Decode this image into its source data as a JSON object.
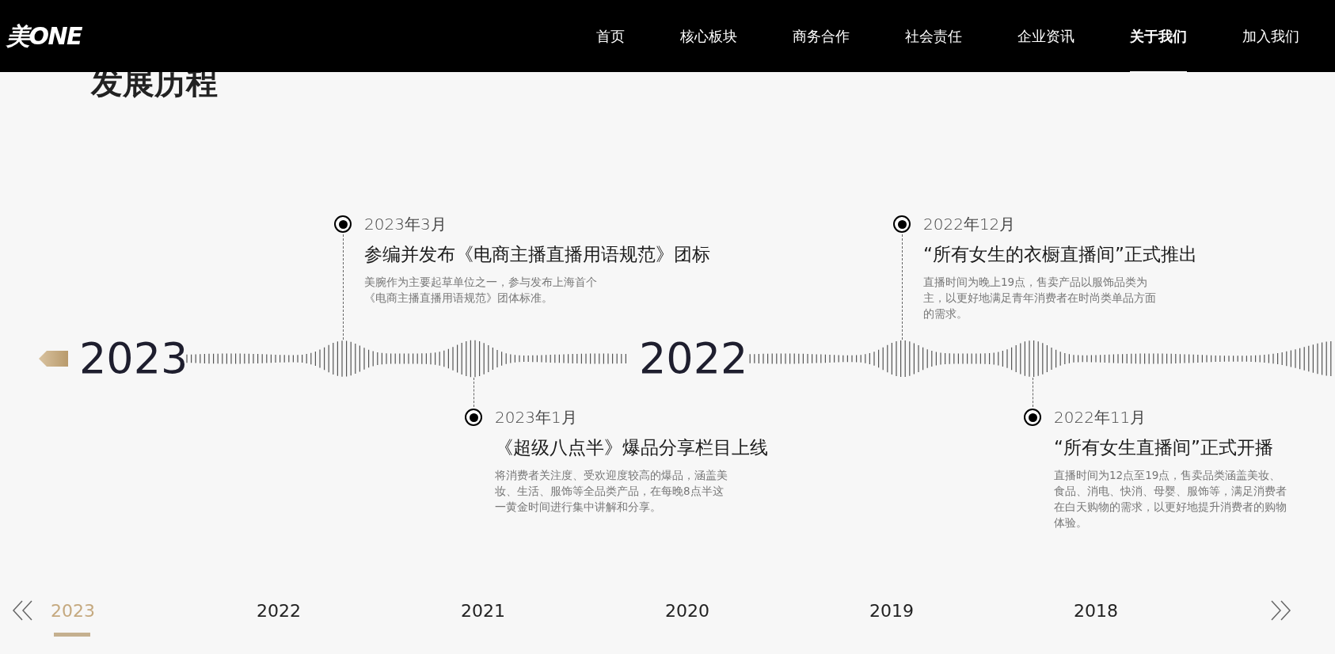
{
  "header": {
    "logo": "美ONE",
    "nav": [
      {
        "label": "首页",
        "selected": false
      },
      {
        "label": "核心板块",
        "selected": false
      },
      {
        "label": "商务合作",
        "selected": false
      },
      {
        "label": "社会责任",
        "selected": false
      },
      {
        "label": "企业资讯",
        "selected": false
      },
      {
        "label": "关于我们",
        "selected": true
      },
      {
        "label": "加入我们",
        "selected": false
      }
    ]
  },
  "section": {
    "title": "发展历程"
  },
  "timeline": {
    "years": [
      "2023",
      "2022"
    ],
    "events": [
      {
        "kind": "above",
        "date": "2023年3月",
        "title": "参编并发布《电商主播直播用语规范》团标",
        "description": "美腕作为主要起草单位之一，参与发布上海首个《电商主播直播用语规范》团体标准。"
      },
      {
        "kind": "below",
        "date": "2023年1月",
        "title": "《超级八点半》爆品分享栏目上线",
        "description": "将消费者关注度、受欢迎度较高的爆品，涵盖美妆、生活、服饰等全品类产品，在每晚8点半这一黄金时间进行集中讲解和分享。"
      },
      {
        "kind": "above",
        "date": "2022年12月",
        "title": "“所有女生的衣橱直播间”正式推出",
        "description": "直播时间为晚上19点，售卖产品以服饰品类为主，以更好地满足青年消费者在时尚类单品方面的需求。"
      },
      {
        "kind": "below",
        "date": "2022年11月",
        "title": "“所有女生直播间”正式开播",
        "description": "直播时间为12点至19点，售卖品类涵盖美妆、食品、消电、快消、母婴、服饰等，满足消费者在白天购物的需求，以更好地提升消费者的购物体验。"
      }
    ]
  },
  "year_nav": [
    {
      "label": "2023",
      "selected": true
    },
    {
      "label": "2022",
      "selected": false
    },
    {
      "label": "2021",
      "selected": false
    },
    {
      "label": "2020",
      "selected": false
    },
    {
      "label": "2019",
      "selected": false
    },
    {
      "label": "2018",
      "selected": false
    }
  ]
}
